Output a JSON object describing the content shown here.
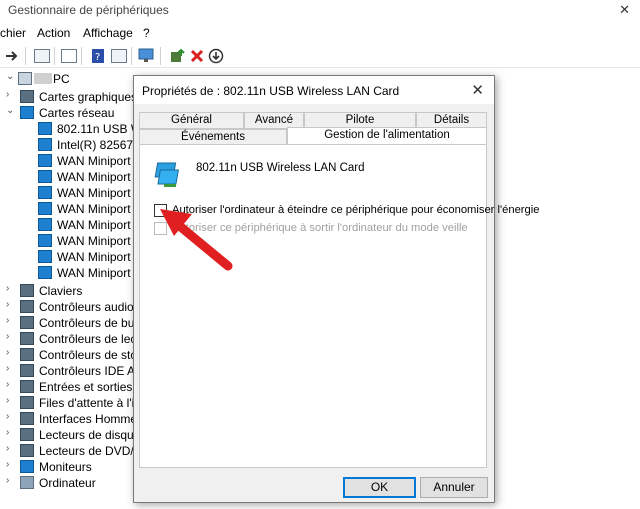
{
  "window": {
    "title": "Gestionnaire de périphériques",
    "close_glyph": "✕"
  },
  "menu": [
    "chier",
    "Action",
    "Affichage",
    "?"
  ],
  "tree": {
    "root": "PC",
    "rows": [
      {
        "label": "Cartes graphiques",
        "chevron": "›",
        "icon": "display-adapter-icon",
        "level": 1
      },
      {
        "label": "Cartes réseau",
        "chevron": "⌄",
        "icon": "network-adapter-icon",
        "level": 1
      },
      {
        "label": "802.11n USB Wir",
        "icon": "network-card-icon",
        "level": 2
      },
      {
        "label": "Intel(R) 82567LM",
        "icon": "network-card-icon",
        "level": 2
      },
      {
        "label": "WAN Miniport (",
        "icon": "network-card-icon",
        "level": 2
      },
      {
        "label": "WAN Miniport (",
        "icon": "network-card-icon",
        "level": 2
      },
      {
        "label": "WAN Miniport (",
        "icon": "network-card-icon",
        "level": 2
      },
      {
        "label": "WAN Miniport (",
        "icon": "network-card-icon",
        "level": 2
      },
      {
        "label": "WAN Miniport (",
        "icon": "network-card-icon",
        "level": 2
      },
      {
        "label": "WAN Miniport (",
        "icon": "network-card-icon",
        "level": 2
      },
      {
        "label": "WAN Miniport (",
        "icon": "network-card-icon",
        "level": 2
      },
      {
        "label": "WAN Miniport (",
        "icon": "network-card-icon",
        "level": 2
      },
      {
        "label": "Claviers",
        "chevron": "›",
        "icon": "keyboard-icon",
        "level": 1
      },
      {
        "label": "Contrôleurs audio, v",
        "chevron": "›",
        "icon": "audio-icon",
        "level": 1
      },
      {
        "label": "Contrôleurs de bus",
        "chevron": "›",
        "icon": "usb-icon",
        "level": 1
      },
      {
        "label": "Contrôleurs de lecte",
        "chevron": "›",
        "icon": "card-reader-icon",
        "level": 1
      },
      {
        "label": "Contrôleurs de stoc",
        "chevron": "›",
        "icon": "storage-controller-icon",
        "level": 1
      },
      {
        "label": "Contrôleurs IDE ATA",
        "chevron": "›",
        "icon": "ide-icon",
        "level": 1
      },
      {
        "label": "Entrées et sorties au",
        "chevron": "›",
        "icon": "audio-io-icon",
        "level": 1
      },
      {
        "label": "Files d'attente à l'im",
        "chevron": "›",
        "icon": "print-queue-icon",
        "level": 1
      },
      {
        "label": "Interfaces Homme-",
        "chevron": "›",
        "icon": "hid-icon",
        "level": 1
      },
      {
        "label": "Lecteurs de disque",
        "chevron": "›",
        "icon": "disk-drive-icon",
        "level": 1
      },
      {
        "label": "Lecteurs de DVD/CD",
        "chevron": "›",
        "icon": "dvd-icon",
        "level": 1
      },
      {
        "label": "Moniteurs",
        "chevron": "›",
        "icon": "monitor-icon",
        "level": 1
      },
      {
        "label": "Ordinateur",
        "chevron": "›",
        "icon": "computer-icon",
        "level": 1
      }
    ]
  },
  "dialog": {
    "title": "Propriétés de : 802.11n USB Wireless LAN Card",
    "close_glyph": "✕",
    "tabs_row1": [
      "Général",
      "Avancé",
      "Pilote",
      "Détails"
    ],
    "tabs_row2": [
      "Événements",
      "Gestion de l'alimentation"
    ],
    "active_tab": "Gestion de l'alimentation",
    "device_name": "802.11n USB Wireless LAN Card",
    "option1": "Autoriser l'ordinateur à éteindre ce périphérique pour économiser l'énergie",
    "option2": "Autoriser ce périphérique à sortir l'ordinateur du mode veille",
    "option1_checked": false,
    "option2_enabled": false,
    "ok_label": "OK",
    "cancel_label": "Annuler"
  },
  "colors": {
    "accent": "#0078d7",
    "annotation_arrow": "#e02020",
    "delete_icon": "#d81e1e"
  }
}
